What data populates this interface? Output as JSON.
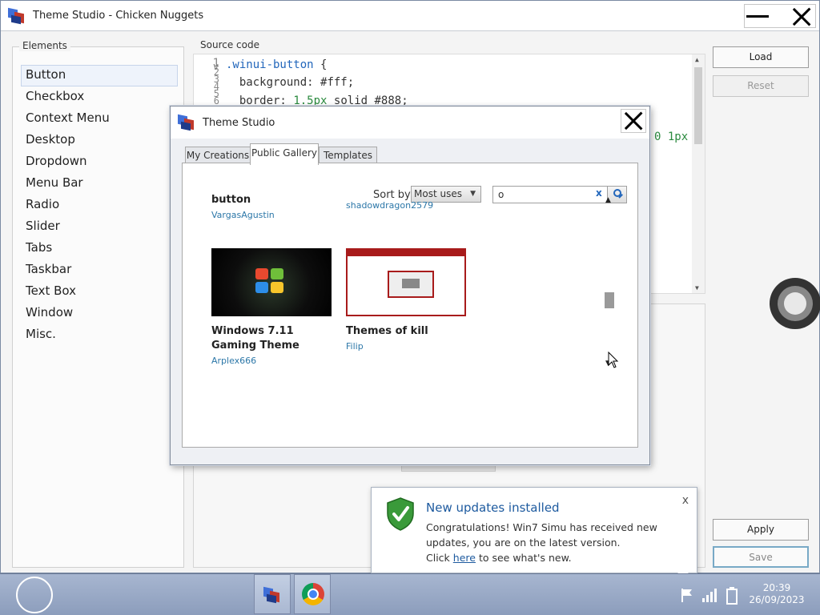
{
  "window": {
    "title": "Theme Studio - Chicken Nuggets"
  },
  "elements_panel": {
    "legend": "Elements",
    "items": [
      "Button",
      "Checkbox",
      "Context Menu",
      "Desktop",
      "Dropdown",
      "Menu Bar",
      "Radio",
      "Slider",
      "Tabs",
      "Taskbar",
      "Text Box",
      "Window",
      "Misc."
    ],
    "selected": "Button"
  },
  "source_panel": {
    "legend": "Source code",
    "line_numbers": [
      "1",
      "2",
      "3",
      "4",
      "5",
      "6"
    ],
    "fold_marker": "v",
    "lines": [
      {
        "selector": ".winui-button",
        "brace": " {"
      },
      {
        "prop": "background:",
        "value": "#fff;"
      },
      {
        "prop": "border:",
        "value_num": "1.5px",
        "value_rest": "solid #888;"
      }
    ],
    "overflow_text": "0 1px"
  },
  "side_buttons": {
    "load": "Load",
    "reset": "Reset",
    "apply": "Apply",
    "save": "Save"
  },
  "dialog": {
    "title": "Theme Studio",
    "tabs": [
      "My Creations",
      "Public Gallery",
      "Templates"
    ],
    "active_tab": "Public Gallery",
    "sort_label": "Sort by",
    "sort_value": "Most uses",
    "search_value": "o",
    "search_clear": "x",
    "gallery": [
      {
        "title": "button",
        "author": "VargasAgustin"
      },
      {
        "title": "",
        "author": "shadowdragon2579"
      },
      {
        "title": "Windows 7.11 Gaming Theme",
        "author": "Arplex666"
      },
      {
        "title": "Themes of kill",
        "author": "Filip"
      }
    ]
  },
  "notification": {
    "title": "New updates installed",
    "body_prefix": "Congratulations! Win7 Simu has received new updates, you are on the latest version.",
    "click_word": "Click",
    "link_text": "here",
    "body_suffix": "to see what's new.",
    "close": "x"
  },
  "taskbar": {
    "time": "20:39",
    "date": "26/09/2023"
  },
  "colors": {
    "link": "#2c77a8",
    "accent": "#1d5a9f",
    "thumb_red": "#a81b1b"
  },
  "icons": [
    "app-icon",
    "minimize-icon",
    "close-icon",
    "search-icon",
    "shield-check-icon",
    "chrome-icon",
    "flag-icon",
    "signal-icon",
    "battery-icon"
  ]
}
